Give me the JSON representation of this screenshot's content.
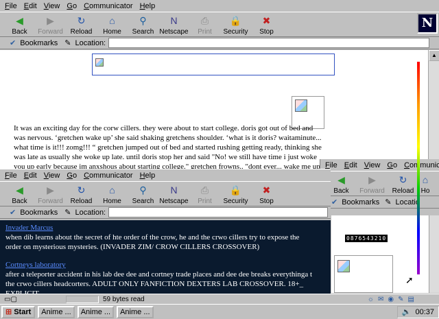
{
  "menu": [
    "File",
    "Edit",
    "View",
    "Go",
    "Communicator",
    "Help"
  ],
  "toolbar": [
    {
      "label": "Back",
      "icon": "back-arrow-icon",
      "enabled": true
    },
    {
      "label": "Forward",
      "icon": "forward-arrow-icon",
      "enabled": false
    },
    {
      "label": "Reload",
      "icon": "reload-icon",
      "enabled": true
    },
    {
      "label": "Home",
      "icon": "home-icon",
      "enabled": true
    },
    {
      "label": "Search",
      "icon": "search-icon",
      "enabled": true
    },
    {
      "label": "Netscape",
      "icon": "netscape-icon",
      "enabled": true
    },
    {
      "label": "Print",
      "icon": "print-icon",
      "enabled": false
    },
    {
      "label": "Security",
      "icon": "security-lock-icon",
      "enabled": true
    },
    {
      "label": "Stop",
      "icon": "stop-icon",
      "enabled": true
    }
  ],
  "toolbar_right": [
    {
      "label": "Back",
      "enabled": true
    },
    {
      "label": "Forward",
      "enabled": false
    },
    {
      "label": "Reload",
      "enabled": true
    },
    {
      "label": "Ho",
      "enabled": true
    }
  ],
  "bookmarks_label": "Bookmarks",
  "location_label": "Location:",
  "location_label_right": "Locatio",
  "story_text": "It was an exciting day for the corw cillers. they were about to start college. doris got out of bed and was nervous. ‘gretchen wake up’ she said shaking gretchens shoulder. ‘what is it doris? waitaminute... what time is it!!! zomg!!! “ gretchen jumped out of bed and started rushing getting ready, thinking she was late as usually she woke up late. until doris stop her and said \"No! we still have time i just woke you up early because im anxshous about starting college.\" gretchen frowns.. \"dont ever... wake me up early...\" \"yeah i know I",
  "entries": [
    {
      "title": "Invader Marcus",
      "desc": "when dib learns about the secret of hte order of the crow, he and the crwo cillers try to expose the order on mysterious mysteries. (INVADER ZIM/ CROW CILLERS CROSSOVER)"
    },
    {
      "title": "Cortneys laboratory",
      "desc": "after a teleporter accident in his lab dee dee and cortney trade places and dee dee breaks everythinga t the crwo cillers headcorters. ADULT ONLY FANFICTION DEXTERS LAB CROSSOVER. 18+_ EXPLICIT."
    }
  ],
  "counter": "0876543210",
  "status_text": "59 bytes read",
  "taskbar": {
    "start_label": "Start",
    "tasks": [
      "Anime ...",
      "Anime ...",
      "Anime ..."
    ],
    "clock": "00:37"
  },
  "colors": {
    "dark_bg": "#0a1a2e",
    "link": "#5a8cff"
  }
}
